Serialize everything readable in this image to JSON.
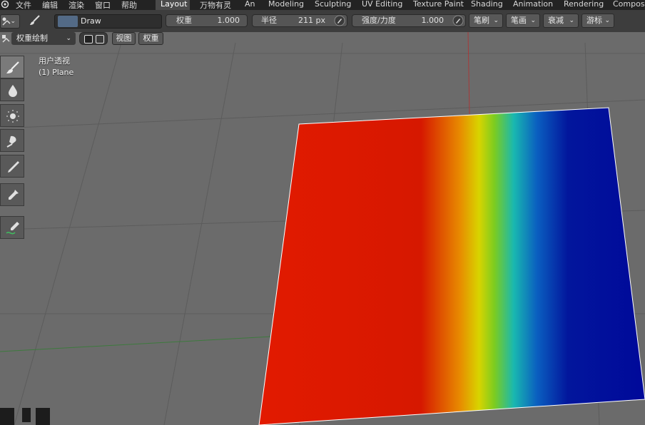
{
  "top_menu": {
    "items": [
      "文件",
      "编辑",
      "渲染",
      "窗口",
      "帮助"
    ],
    "workspaces": [
      "Layout",
      "万物有灵",
      "An",
      "Modeling",
      "Sculpting",
      "UV Editing",
      "Texture Paint",
      "Shading",
      "Animation",
      "Rendering",
      "Composit"
    ],
    "active_workspace": "Layout"
  },
  "tool_header": {
    "brush_name": "Draw",
    "weight_label": "权重",
    "weight_value": "1.000",
    "radius_label": "半径",
    "radius_value": "211 px",
    "strength_label": "强度/力度",
    "strength_value": "1.000",
    "dropdowns": [
      "笔刷",
      "笔画",
      "衰减",
      "游标"
    ]
  },
  "viewport_header": {
    "mode": "权重绘制",
    "view_menu": "视图",
    "weights_menu": "权重"
  },
  "viewport": {
    "view_name": "用户透视",
    "object_label": "(1) Plane"
  },
  "toolbar": {
    "tools": [
      "draw",
      "blur",
      "average",
      "smear",
      "gradient",
      "sample-weight",
      "annotate"
    ],
    "active_tool": "draw"
  },
  "colors": {
    "background": "#6b6b6b",
    "header": "#3d3d3d",
    "topbar": "#232323",
    "accent_red_axis": "#b04040",
    "accent_green_axis": "#3f7a3f"
  }
}
